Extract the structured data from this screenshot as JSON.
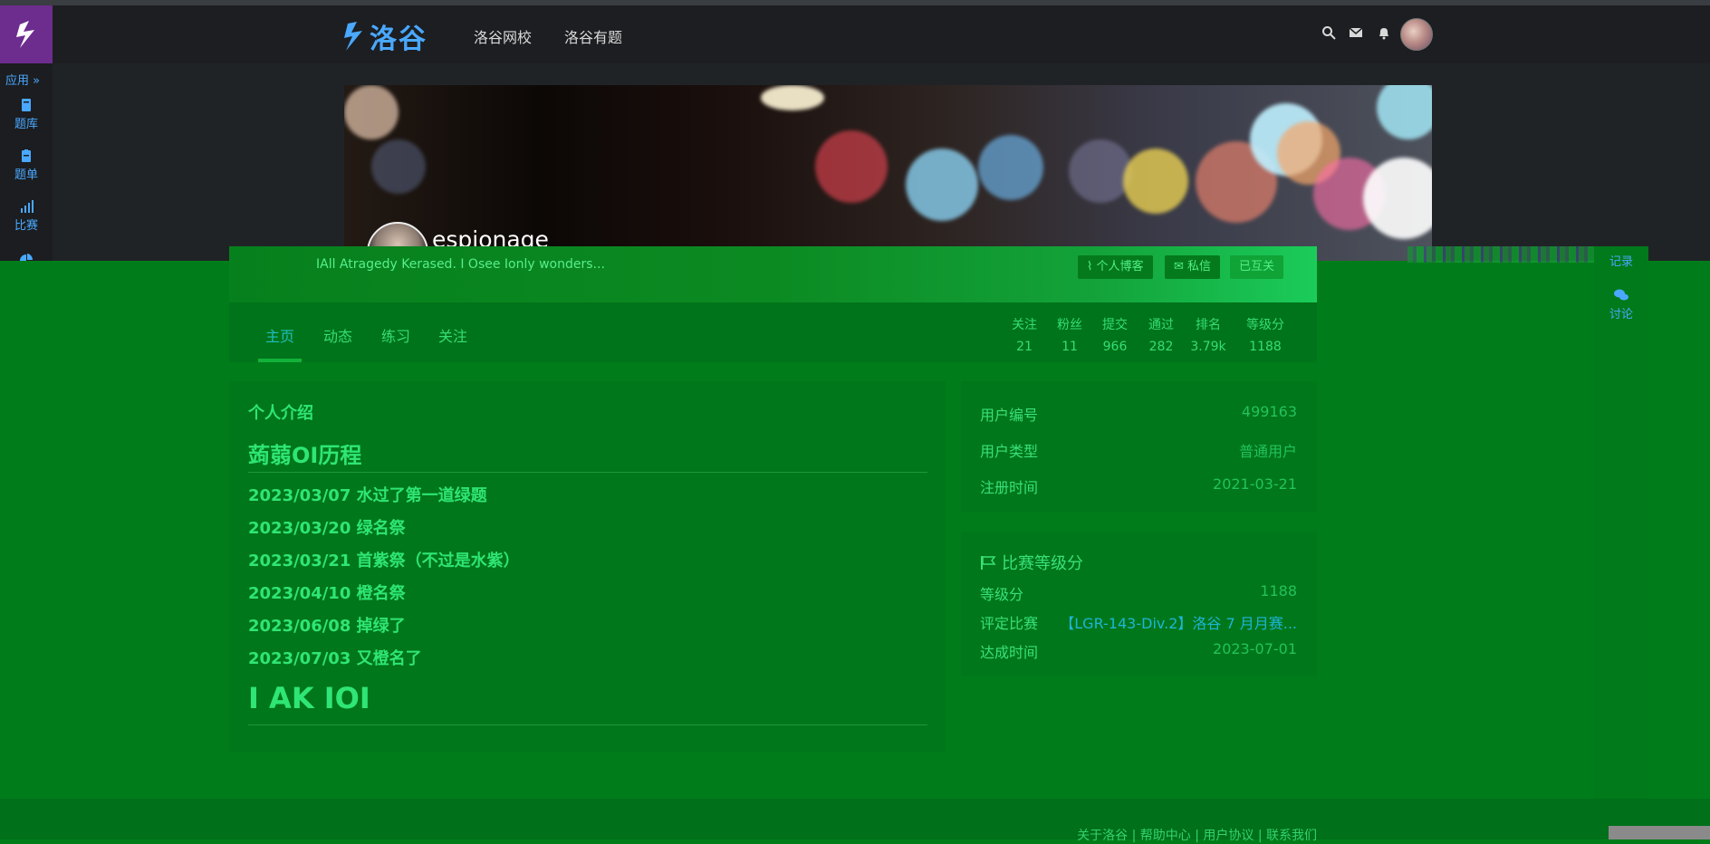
{
  "sidebar": {
    "apps_label": "应用 »",
    "items": [
      {
        "label": "题库",
        "icon": "book-icon"
      },
      {
        "label": "题单",
        "icon": "clipboard-icon"
      },
      {
        "label": "比赛",
        "icon": "bar-chart-icon"
      }
    ]
  },
  "header": {
    "brand": "洛谷",
    "nav": [
      "洛谷网校",
      "洛谷有题"
    ]
  },
  "user": {
    "name": "espionage",
    "motto": "IAll Atragedy Kerased. I Osee Ionly wonders...",
    "buttons": {
      "blog": "个人博客",
      "message": "私信",
      "follow": "已互关"
    }
  },
  "tabs": [
    "主页",
    "动态",
    "练习",
    "关注"
  ],
  "stats": [
    {
      "label": "关注",
      "value": "21"
    },
    {
      "label": "粉丝",
      "value": "11"
    },
    {
      "label": "提交",
      "value": "966"
    },
    {
      "label": "通过",
      "value": "282"
    },
    {
      "label": "排名",
      "value": "3.79k"
    },
    {
      "label": "等级分",
      "value": "1188"
    }
  ],
  "intro": {
    "title": "个人介绍",
    "heading": "蒟蒻OI历程",
    "logs": [
      "2023/03/07 水过了第一道绿题",
      "2023/03/20 绿名祭",
      "2023/03/21 首紫祭（不过是水紫）",
      "2023/04/10 橙名祭",
      "2023/06/08 掉绿了",
      "2023/07/03 又橙名了"
    ],
    "big": "I AK IOI"
  },
  "info": [
    {
      "key": "用户编号",
      "value": "499163"
    },
    {
      "key": "用户类型",
      "value": "普通用户"
    },
    {
      "key": "注册时间",
      "value": "2021-03-21"
    }
  ],
  "rating": {
    "title": "比赛等级分",
    "rows": [
      {
        "key": "等级分",
        "value": "1188"
      },
      {
        "key": "评定比赛",
        "value": "【LGR-143-Div.2】洛谷 7 月月赛..."
      },
      {
        "key": "达成时间",
        "value": "2023-07-01"
      }
    ]
  },
  "right_nav": [
    {
      "label": "记录",
      "icon": "record-icon"
    },
    {
      "label": "讨论",
      "icon": "chat-icon"
    }
  ],
  "footer": "关于洛谷 | 帮助中心 | 用户协议 | 联系我们",
  "colors": {
    "accent": "#4aa8ff",
    "brand_purple": "#6d2d8e",
    "overlay_green": "#007d1a"
  }
}
